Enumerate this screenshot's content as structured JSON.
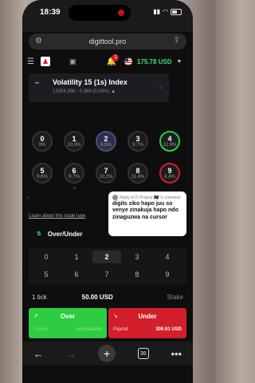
{
  "status": {
    "time": "18:39"
  },
  "browser": {
    "url": "digittool.pro"
  },
  "header": {
    "notification_count": "1",
    "balance": "175.78 USD"
  },
  "market": {
    "name": "Volatility 15 (1s) Index",
    "price": "13354.356 - 0.389 (0.00%)"
  },
  "digits": [
    {
      "digit": "0",
      "percent": "9%"
    },
    {
      "digit": "1",
      "percent": "10.9%"
    },
    {
      "digit": "2",
      "percent": "8.5%"
    },
    {
      "digit": "3",
      "percent": "9.7%"
    },
    {
      "digit": "4",
      "percent": "12.6%"
    },
    {
      "digit": "5",
      "percent": "9.6%"
    },
    {
      "digit": "6",
      "percent": "9.7%"
    },
    {
      "digit": "7",
      "percent": "10.2%"
    },
    {
      "digit": "8",
      "percent": "11.4%"
    },
    {
      "digit": "9",
      "percent": "8.4%"
    }
  ],
  "trade": {
    "learn_link": "Learn about this trade type",
    "type": "Over/Under",
    "prediction_digits": [
      "0",
      "1",
      "2",
      "3",
      "4",
      "5",
      "6",
      "7",
      "8",
      "9"
    ],
    "selected_digit": "2",
    "duration": "1 tick",
    "stake": "50.00 USD",
    "stake_label": "Stake"
  },
  "buttons": {
    "over": {
      "label": "Over",
      "payout_label": "Payout",
      "amount": "unavailable"
    },
    "under": {
      "label": "Under",
      "payout_label": "Payout",
      "amount": "206.61 USD"
    }
  },
  "comment": {
    "reply_to": "Reply to D Pnayne 🇰🇪 's comment",
    "text": "digits ziko hapo juu so venye zinakuja hapo ndo zinaguzwa na cursor"
  },
  "toolbar": {
    "tab_count": "36"
  },
  "colors": {
    "green": "#2ecc40",
    "red": "#d21f2b",
    "balance_green": "#3ddc84"
  }
}
